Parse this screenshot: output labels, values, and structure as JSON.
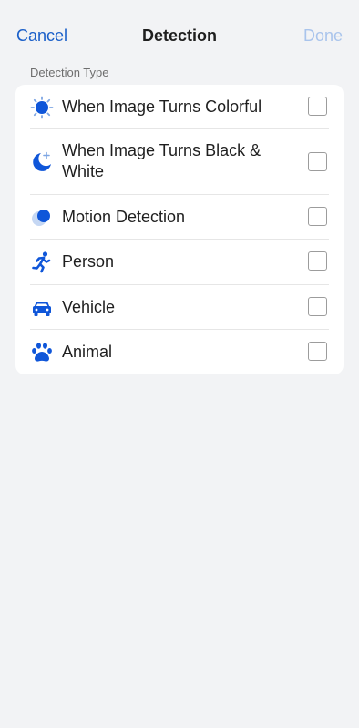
{
  "nav": {
    "cancel_label": "Cancel",
    "title": "Detection",
    "done_label": "Done"
  },
  "section": {
    "label": "Detection Type"
  },
  "items": [
    {
      "icon": "sun-icon",
      "label": "When Image Turns Colorful",
      "checked": false
    },
    {
      "icon": "moon-icon",
      "label": "When Image Turns Black & White",
      "checked": false
    },
    {
      "icon": "motion-icon",
      "label": "Motion Detection",
      "checked": false
    },
    {
      "icon": "person-running-icon",
      "label": "Person",
      "checked": false
    },
    {
      "icon": "car-icon",
      "label": "Vehicle",
      "checked": false
    },
    {
      "icon": "paw-icon",
      "label": "Animal",
      "checked": false
    }
  ],
  "colors": {
    "accent": "#1a5fc9",
    "accent_disabled": "#a9c4ec",
    "background": "#f2f3f5",
    "card": "#ffffff"
  }
}
